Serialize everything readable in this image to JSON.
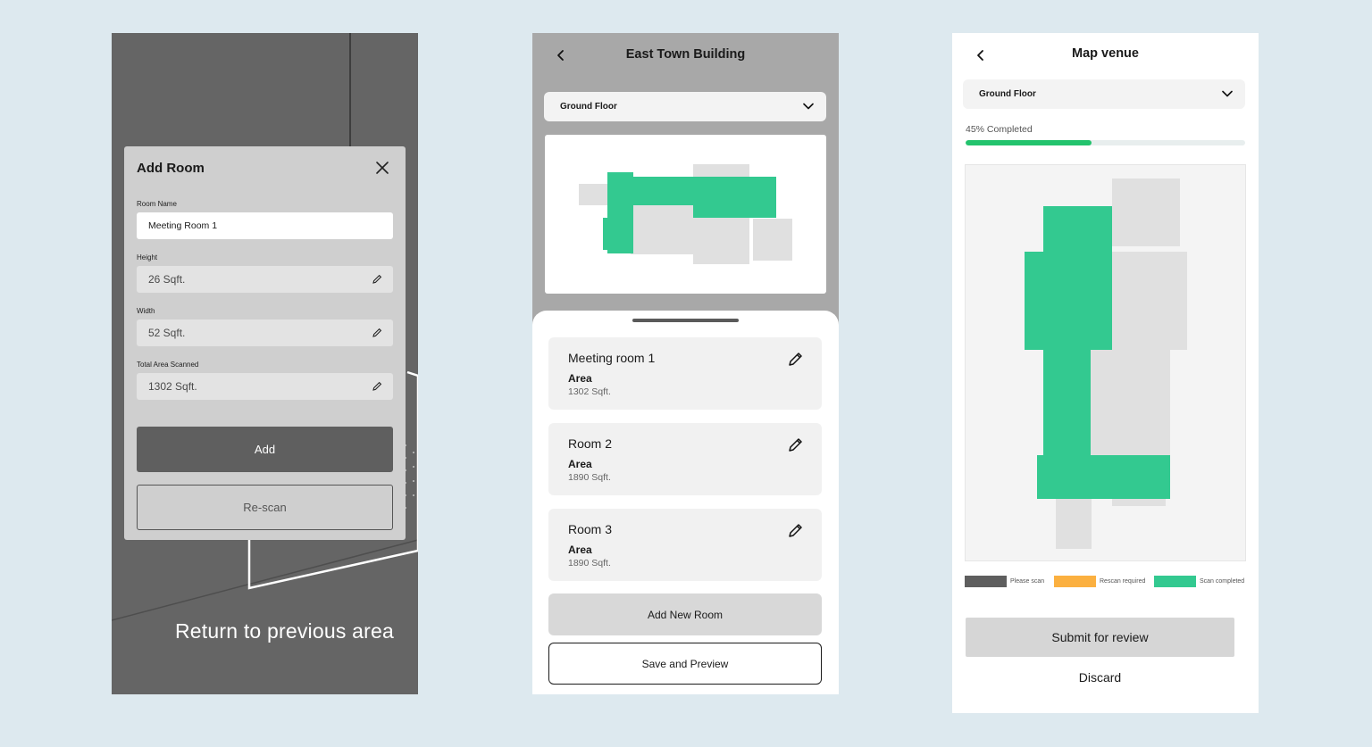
{
  "add_room": {
    "title": "Add Room",
    "room_name_label": "Room Name",
    "room_name_value": "Meeting Room 1",
    "height_label": "Height",
    "height_value": "26 Sqft.",
    "width_label": "Width",
    "width_value": "52 Sqft.",
    "total_area_label": "Total Area Scanned",
    "total_area_value": "1302 Sqft.",
    "add_label": "Add",
    "rescan_label": "Re-scan",
    "return_hint": "Return to previous area"
  },
  "building": {
    "title": "East Town Building",
    "floor_selected": "Ground Floor",
    "rooms": [
      {
        "name": "Meeting room 1",
        "area_label": "Area",
        "area_value": "1302 Sqft."
      },
      {
        "name": "Room 2",
        "area_label": "Area",
        "area_value": "1890 Sqft."
      },
      {
        "name": "Room 3",
        "area_label": "Area",
        "area_value": "1890 Sqft."
      }
    ],
    "add_new_room_label": "Add New Room",
    "save_preview_label": "Save and Preview"
  },
  "map_venue": {
    "title": "Map venue",
    "floor_selected": "Ground Floor",
    "progress_text": "45% Completed",
    "progress_percent": 45,
    "legend": [
      {
        "label": "Please scan",
        "color": "#5e5e5e"
      },
      {
        "label": "Rescan required",
        "color": "#fbb040"
      },
      {
        "label": "Scan completed",
        "color": "#33c990"
      }
    ],
    "submit_label": "Submit for review",
    "discard_label": "Discard"
  },
  "colors": {
    "accent_green": "#33c990",
    "progress_green": "#23c36d",
    "room_grey": "#e0e0e0"
  }
}
